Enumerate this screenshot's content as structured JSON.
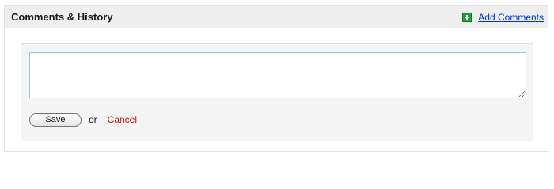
{
  "panel": {
    "title": "Comments & History",
    "add_comments_label": "Add Comments",
    "add_icon": "plus-icon",
    "accent_color": "#17a33a"
  },
  "comment_form": {
    "textarea_value": "",
    "save_label": "Save",
    "or_text": "or",
    "cancel_label": "Cancel",
    "link_color": "#0033cc",
    "cancel_color": "#cc1100"
  }
}
